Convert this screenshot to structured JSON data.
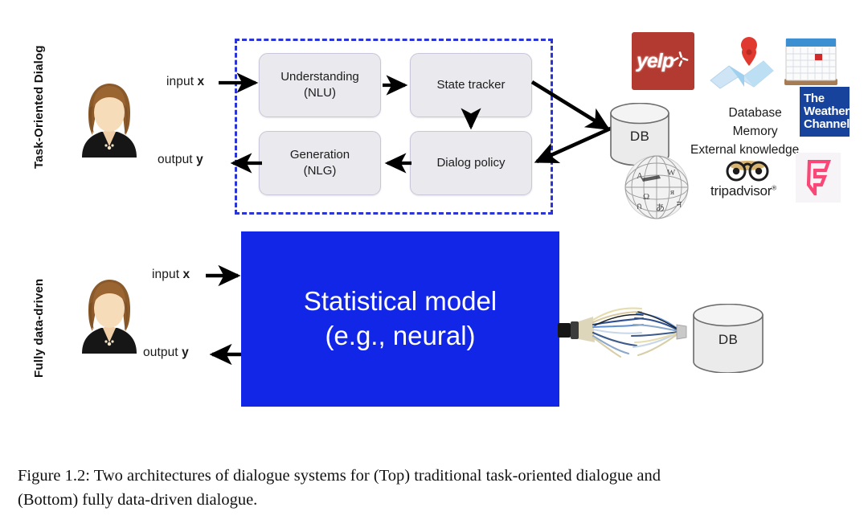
{
  "figure": {
    "sections": [
      {
        "id": "task-oriented",
        "label": "Task-Oriented Dialog"
      },
      {
        "id": "fully-data-driven",
        "label": "Fully data-driven"
      }
    ],
    "top": {
      "io": {
        "input_label_text": "input ",
        "input_var": "x",
        "output_label_text": "output ",
        "output_var": "y"
      },
      "pipeline_boxes": [
        {
          "id": "nlu",
          "line1": "Understanding",
          "line2": "(NLU)"
        },
        {
          "id": "state-tracker",
          "line1": "State tracker",
          "line2": ""
        },
        {
          "id": "dialog-policy",
          "line1": "Dialog policy",
          "line2": ""
        },
        {
          "id": "nlg",
          "line1": "Generation",
          "line2": "(NLG)"
        }
      ],
      "database": {
        "label": "DB"
      },
      "knowledge_lines": [
        "Database",
        "Memory",
        "External knowledge"
      ],
      "logos": [
        {
          "id": "yelp",
          "name": "yelp-logo",
          "text": "yelp"
        },
        {
          "id": "maps",
          "name": "maps-icon",
          "text": ""
        },
        {
          "id": "calendar",
          "name": "calendar-icon",
          "text": ""
        },
        {
          "id": "weather-channel",
          "name": "weather-channel-logo",
          "lines": [
            "The",
            "Weather",
            "Channel"
          ]
        },
        {
          "id": "wikipedia",
          "name": "wikipedia-globe-icon",
          "text": ""
        },
        {
          "id": "tripadvisor",
          "name": "tripadvisor-logo",
          "text": "tripadvisor",
          "mark": "®"
        },
        {
          "id": "foursquare",
          "name": "foursquare-logo",
          "text": "F"
        }
      ]
    },
    "bottom": {
      "io": {
        "input_label_text": "input ",
        "input_var": "x",
        "output_label_text": "output ",
        "output_var": "y"
      },
      "model_box": {
        "line1": "Statistical model",
        "line2": "(e.g., neural)"
      },
      "database": {
        "label": "DB"
      },
      "connector": {
        "name": "frayed-cable-icon"
      }
    },
    "colors": {
      "model_blue": "#1226e8",
      "dashed_border": "#2b35d6",
      "process_box_fill": "#e9e9ee",
      "process_box_border": "#c9c6da",
      "yelp_red": "#b33a31",
      "weather_blue": "#18439c",
      "foursquare_pink": "#f94877",
      "db_fill": "#ebebeb",
      "arrow_black": "#000000"
    },
    "caption": {
      "line1": "Figure 1.2:  Two architectures of dialogue systems for (Top) traditional task-oriented dialogue and",
      "line2": "(Bottom) fully data-driven dialogue."
    }
  }
}
